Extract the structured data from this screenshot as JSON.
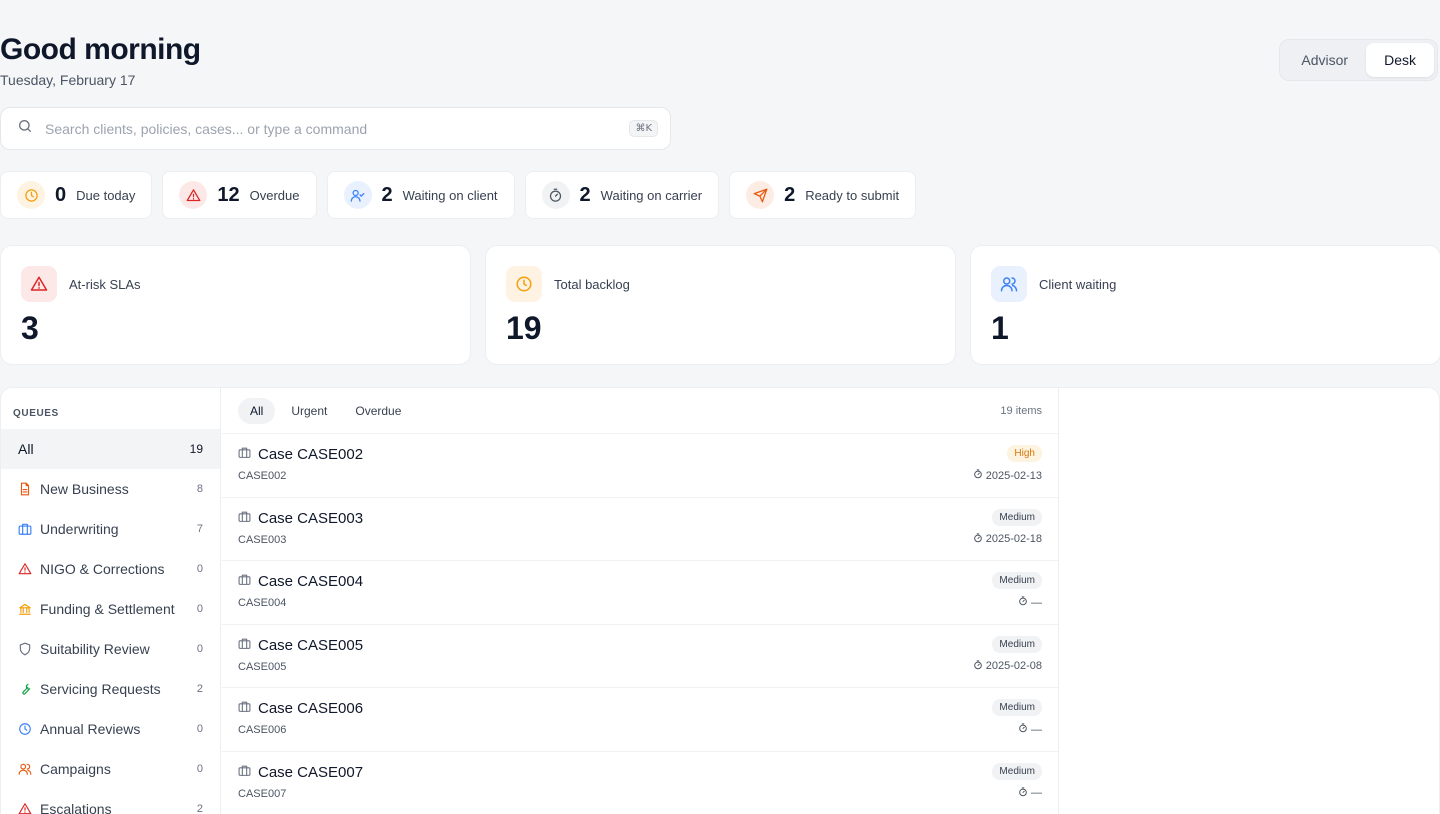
{
  "header": {
    "greeting": "Good morning",
    "date": "Tuesday, February 17"
  },
  "mode": {
    "options": [
      "Advisor",
      "Desk"
    ],
    "selected": "Desk"
  },
  "search": {
    "placeholder": "Search clients, policies, cases... or type a command",
    "shortcut": "⌘K"
  },
  "stats": [
    {
      "value": "0",
      "label": "Due today",
      "icon": "clock-icon",
      "color": "#f59e0b",
      "bg": "#fef3e2"
    },
    {
      "value": "12",
      "label": "Overdue",
      "icon": "alert-triangle-icon",
      "color": "#dc2626",
      "bg": "#fde8e8"
    },
    {
      "value": "2",
      "label": "Waiting on client",
      "icon": "user-check-icon",
      "color": "#3b82f6",
      "bg": "#e8f1fd"
    },
    {
      "value": "2",
      "label": "Waiting on carrier",
      "icon": "timer-icon",
      "color": "#4b5563",
      "bg": "#f1f2f4"
    },
    {
      "value": "2",
      "label": "Ready to submit",
      "icon": "send-icon",
      "color": "#ea580c",
      "bg": "#fdece4"
    }
  ],
  "cards": [
    {
      "title": "At-risk SLAs",
      "value": "3",
      "icon": "alert-triangle-icon",
      "color": "#dc2626",
      "bg": "#fde8e8"
    },
    {
      "title": "Total backlog",
      "value": "19",
      "icon": "clock-icon",
      "color": "#f59e0b",
      "bg": "#fef3e2"
    },
    {
      "title": "Client waiting",
      "value": "1",
      "icon": "users-icon",
      "color": "#3b82f6",
      "bg": "#e8f1fd"
    }
  ],
  "queues": {
    "heading": "QUEUES",
    "items": [
      {
        "label": "All",
        "count": "19",
        "icon": "",
        "color": ""
      },
      {
        "label": "New Business",
        "count": "8",
        "icon": "file-text-icon",
        "color": "#ea580c"
      },
      {
        "label": "Underwriting",
        "count": "7",
        "icon": "briefcase-icon",
        "color": "#3b82f6"
      },
      {
        "label": "NIGO & Corrections",
        "count": "0",
        "icon": "alert-triangle-icon",
        "color": "#dc2626"
      },
      {
        "label": "Funding & Settlement",
        "count": "0",
        "icon": "bank-icon",
        "color": "#f59e0b"
      },
      {
        "label": "Suitability Review",
        "count": "0",
        "icon": "shield-icon",
        "color": "#6b7280"
      },
      {
        "label": "Servicing Requests",
        "count": "2",
        "icon": "wrench-icon",
        "color": "#16a34a"
      },
      {
        "label": "Annual Reviews",
        "count": "0",
        "icon": "clock-icon",
        "color": "#3b82f6"
      },
      {
        "label": "Campaigns",
        "count": "0",
        "icon": "users-icon",
        "color": "#ea580c"
      },
      {
        "label": "Escalations",
        "count": "2",
        "icon": "alert-triangle-icon",
        "color": "#dc2626"
      }
    ]
  },
  "filters": {
    "tabs": [
      "All",
      "Urgent",
      "Overdue"
    ],
    "selected": "All",
    "count": "19 items"
  },
  "cases": [
    {
      "title": "Case CASE002",
      "id": "CASE002",
      "priority": "High",
      "due": "2025-02-13"
    },
    {
      "title": "Case CASE003",
      "id": "CASE003",
      "priority": "Medium",
      "due": "2025-02-18"
    },
    {
      "title": "Case CASE004",
      "id": "CASE004",
      "priority": "Medium",
      "due": "—"
    },
    {
      "title": "Case CASE005",
      "id": "CASE005",
      "priority": "Medium",
      "due": "2025-02-08"
    },
    {
      "title": "Case CASE006",
      "id": "CASE006",
      "priority": "Medium",
      "due": "—"
    },
    {
      "title": "Case CASE007",
      "id": "CASE007",
      "priority": "Medium",
      "due": "—"
    }
  ]
}
